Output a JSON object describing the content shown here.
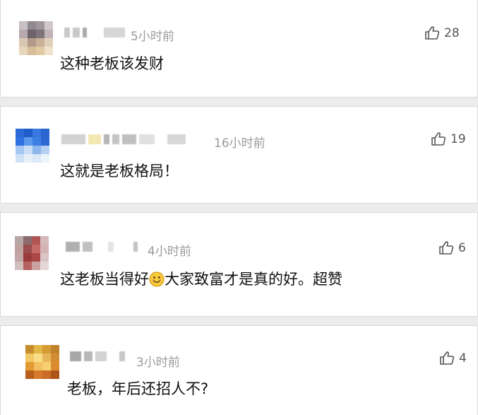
{
  "comments": [
    {
      "time": "5小时前",
      "likes": "28",
      "text": "这种老板该发财"
    },
    {
      "time": "16小时前",
      "likes": "19",
      "text": "这就是老板格局！"
    },
    {
      "time": "4小时前",
      "likes": "6",
      "text_before": "这老板当得好",
      "emoji": "smile-emoji",
      "text_after": "大家致富才是真的好。超赞"
    },
    {
      "time": "3小时前",
      "likes": "4",
      "text": "老板，年后还招人不?"
    }
  ],
  "icons": {
    "like": "thumbs-up-icon",
    "avatar": "blurred-avatar"
  },
  "colors": {
    "background": "#ececec",
    "card": "#ffffff",
    "time_text": "#9a9a9a",
    "likes_text": "#555555",
    "comment_text": "#111111"
  }
}
